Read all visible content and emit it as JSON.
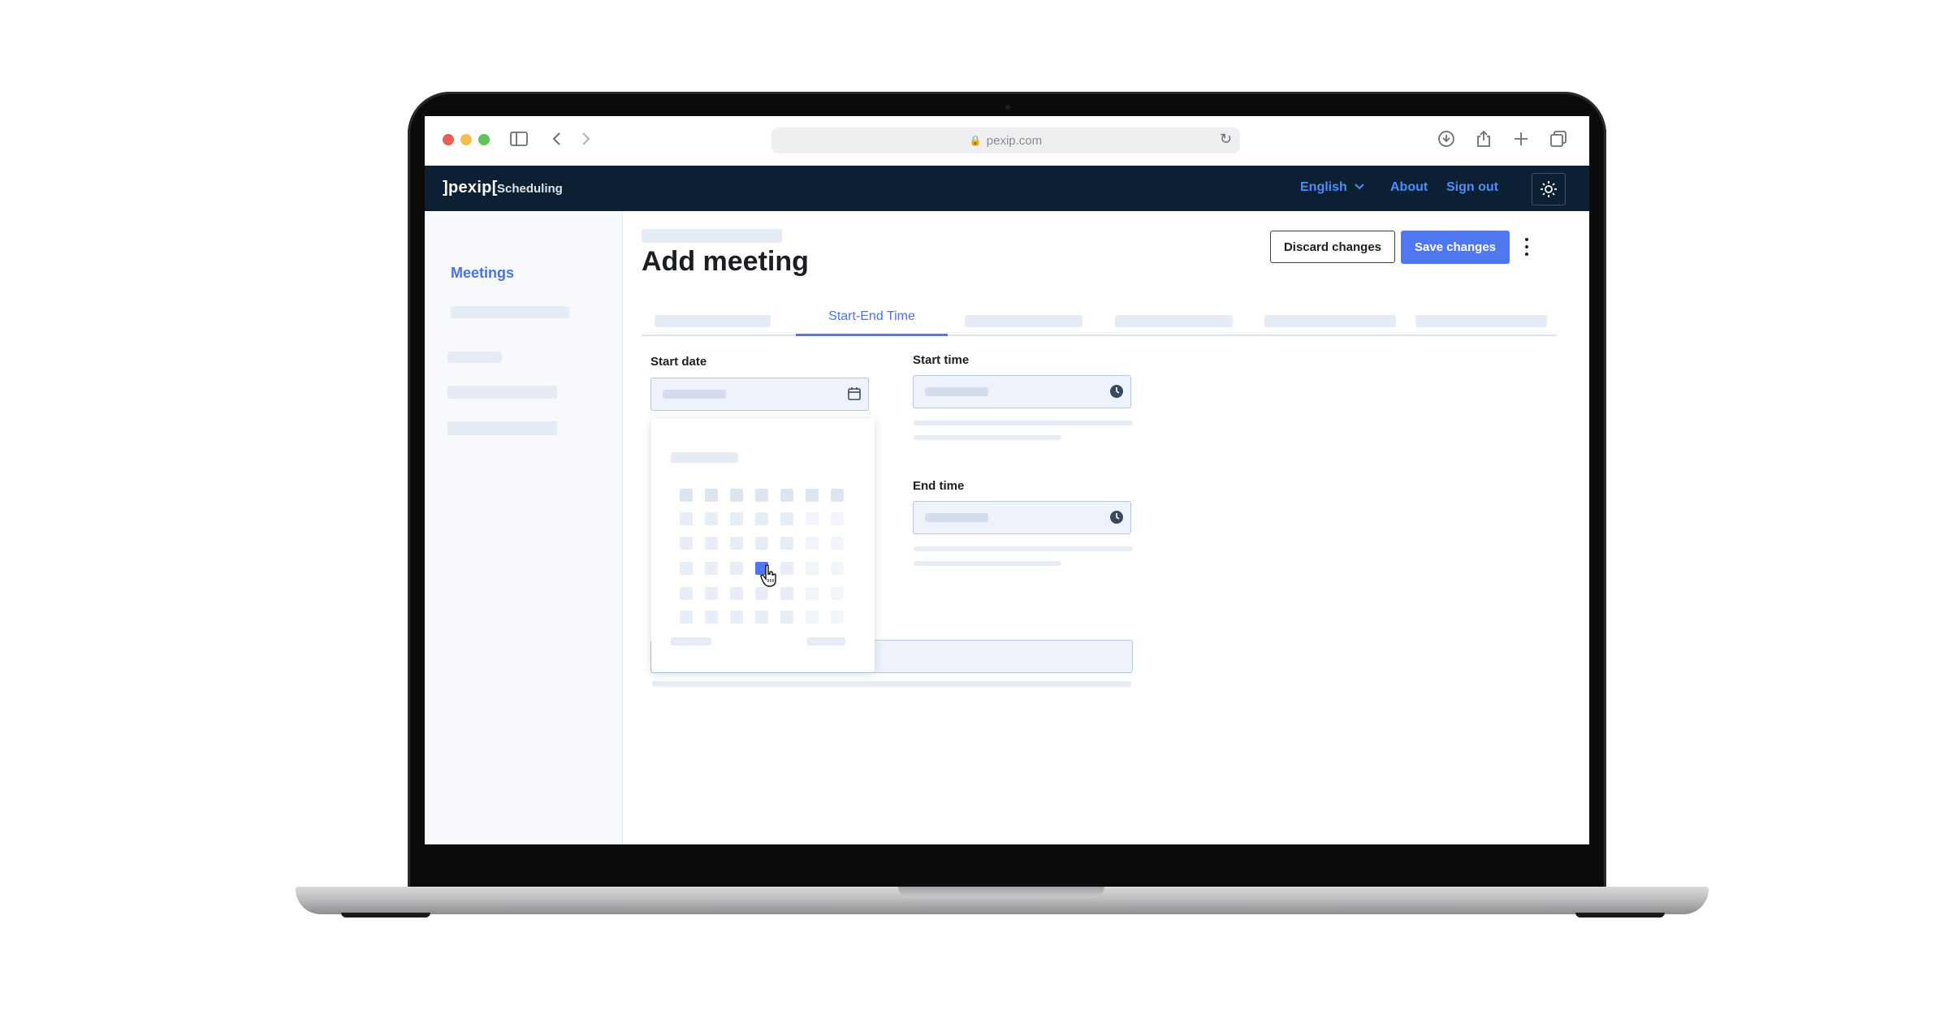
{
  "browser": {
    "url": "pexip.com",
    "lock_glyph": "🔒"
  },
  "app": {
    "logo": "]pexip[",
    "section": "Scheduling",
    "language": "English",
    "about": "About",
    "sign_out": "Sign out"
  },
  "sidebar": {
    "meetings": "Meetings"
  },
  "page": {
    "title": "Add meeting",
    "discard_label": "Discard changes",
    "save_label": "Save changes"
  },
  "tabs": {
    "active": "Start-End Time"
  },
  "form": {
    "start_date_label": "Start date",
    "start_time_label": "Start time",
    "end_time_label": "End time"
  },
  "icons": {
    "sidebar_toggle": "sidebar-icon",
    "back": "chevron-left-icon",
    "forward": "chevron-right-icon",
    "download": "download-icon",
    "share": "share-icon",
    "new_tab": "plus-icon",
    "tabs": "tabs-icon",
    "theme": "sun-icon",
    "calendar": "calendar-icon",
    "clock": "clock-icon",
    "more": "kebab-icon"
  },
  "colors": {
    "header_bg": "#0c2033",
    "accent": "#4f78f0",
    "link": "#4f8df7"
  }
}
